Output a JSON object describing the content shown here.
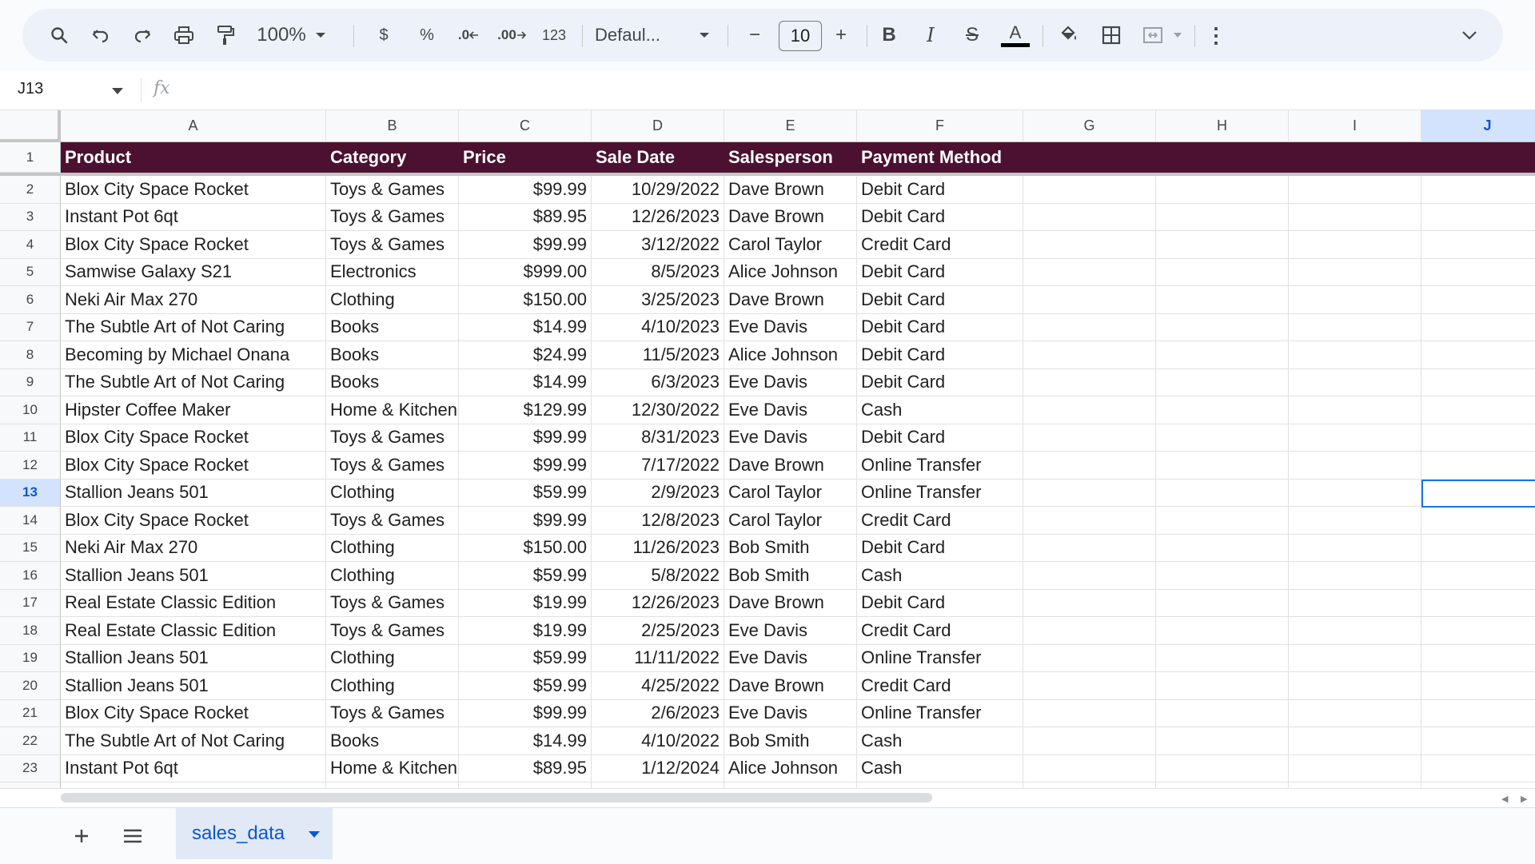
{
  "toolbar": {
    "zoom": "100%",
    "currency": "$",
    "percent": "%",
    "decrease_decimal": ".0",
    "increase_decimal": ".00",
    "number_format": "123",
    "font": "Defaul...",
    "font_size": "10",
    "minus": "−",
    "plus": "+",
    "bold": "B",
    "italic": "I",
    "strike": "S",
    "text_color": "A",
    "more": "⋮"
  },
  "formula_bar": {
    "cell_ref": "J13",
    "fx": "fx",
    "value": ""
  },
  "colors": {
    "header_bg": "#4c1130",
    "selection": "#1a73e8",
    "accent_text": "#0b57d0"
  },
  "columns": [
    "A",
    "B",
    "C",
    "D",
    "E",
    "F",
    "G",
    "H",
    "I",
    "J"
  ],
  "selected_column": "J",
  "selected_row": 13,
  "header_row": [
    "Product",
    "Category",
    "Price",
    "Sale Date",
    "Salesperson",
    "Payment Method"
  ],
  "rows": [
    [
      "Blox City Space Rocket",
      "Toys & Games",
      "$99.99",
      "10/29/2022",
      "Dave Brown",
      "Debit Card"
    ],
    [
      "Instant Pot 6qt",
      "Toys & Games",
      "$89.95",
      "12/26/2023",
      "Dave Brown",
      "Debit Card"
    ],
    [
      "Blox City Space Rocket",
      "Toys & Games",
      "$99.99",
      "3/12/2022",
      "Carol Taylor",
      "Credit Card"
    ],
    [
      "Samwise Galaxy S21",
      "Electronics",
      "$999.00",
      "8/5/2023",
      "Alice Johnson",
      "Debit Card"
    ],
    [
      "Neki Air Max 270",
      "Clothing",
      "$150.00",
      "3/25/2023",
      "Dave Brown",
      "Debit Card"
    ],
    [
      "The Subtle Art of Not Caring",
      "Books",
      "$14.99",
      "4/10/2023",
      "Eve Davis",
      "Debit Card"
    ],
    [
      "Becoming by Michael Onana",
      "Books",
      "$24.99",
      "11/5/2023",
      "Alice Johnson",
      "Debit Card"
    ],
    [
      "The Subtle Art of Not Caring",
      "Books",
      "$14.99",
      "6/3/2023",
      "Eve Davis",
      "Debit Card"
    ],
    [
      "Hipster Coffee Maker",
      "Home & Kitchen",
      "$129.99",
      "12/30/2022",
      "Eve Davis",
      "Cash"
    ],
    [
      "Blox City Space Rocket",
      "Toys & Games",
      "$99.99",
      "8/31/2023",
      "Eve Davis",
      "Debit Card"
    ],
    [
      "Blox City Space Rocket",
      "Toys & Games",
      "$99.99",
      "7/17/2022",
      "Dave Brown",
      "Online Transfer"
    ],
    [
      "Stallion Jeans 501",
      "Clothing",
      "$59.99",
      "2/9/2023",
      "Carol Taylor",
      "Online Transfer"
    ],
    [
      "Blox City Space Rocket",
      "Toys & Games",
      "$99.99",
      "12/8/2023",
      "Carol Taylor",
      "Credit Card"
    ],
    [
      "Neki Air Max 270",
      "Clothing",
      "$150.00",
      "11/26/2023",
      "Bob Smith",
      "Debit Card"
    ],
    [
      "Stallion Jeans 501",
      "Clothing",
      "$59.99",
      "5/8/2022",
      "Bob Smith",
      "Cash"
    ],
    [
      "Real Estate Classic Edition",
      "Toys & Games",
      "$19.99",
      "12/26/2023",
      "Dave Brown",
      "Debit Card"
    ],
    [
      "Real Estate Classic Edition",
      "Toys & Games",
      "$19.99",
      "2/25/2023",
      "Eve Davis",
      "Credit Card"
    ],
    [
      "Stallion Jeans 501",
      "Clothing",
      "$59.99",
      "11/11/2022",
      "Eve Davis",
      "Online Transfer"
    ],
    [
      "Stallion Jeans 501",
      "Clothing",
      "$59.99",
      "4/25/2022",
      "Dave Brown",
      "Credit Card"
    ],
    [
      "Blox City Space Rocket",
      "Toys & Games",
      "$99.99",
      "2/6/2023",
      "Eve Davis",
      "Online Transfer"
    ],
    [
      "The Subtle Art of Not Caring",
      "Books",
      "$14.99",
      "4/10/2022",
      "Bob Smith",
      "Cash"
    ],
    [
      "Instant Pot 6qt",
      "Home & Kitchen",
      "$89.95",
      "1/12/2024",
      "Alice Johnson",
      "Cash"
    ]
  ],
  "sheet_tabs": [
    {
      "label": "sales_data"
    }
  ]
}
